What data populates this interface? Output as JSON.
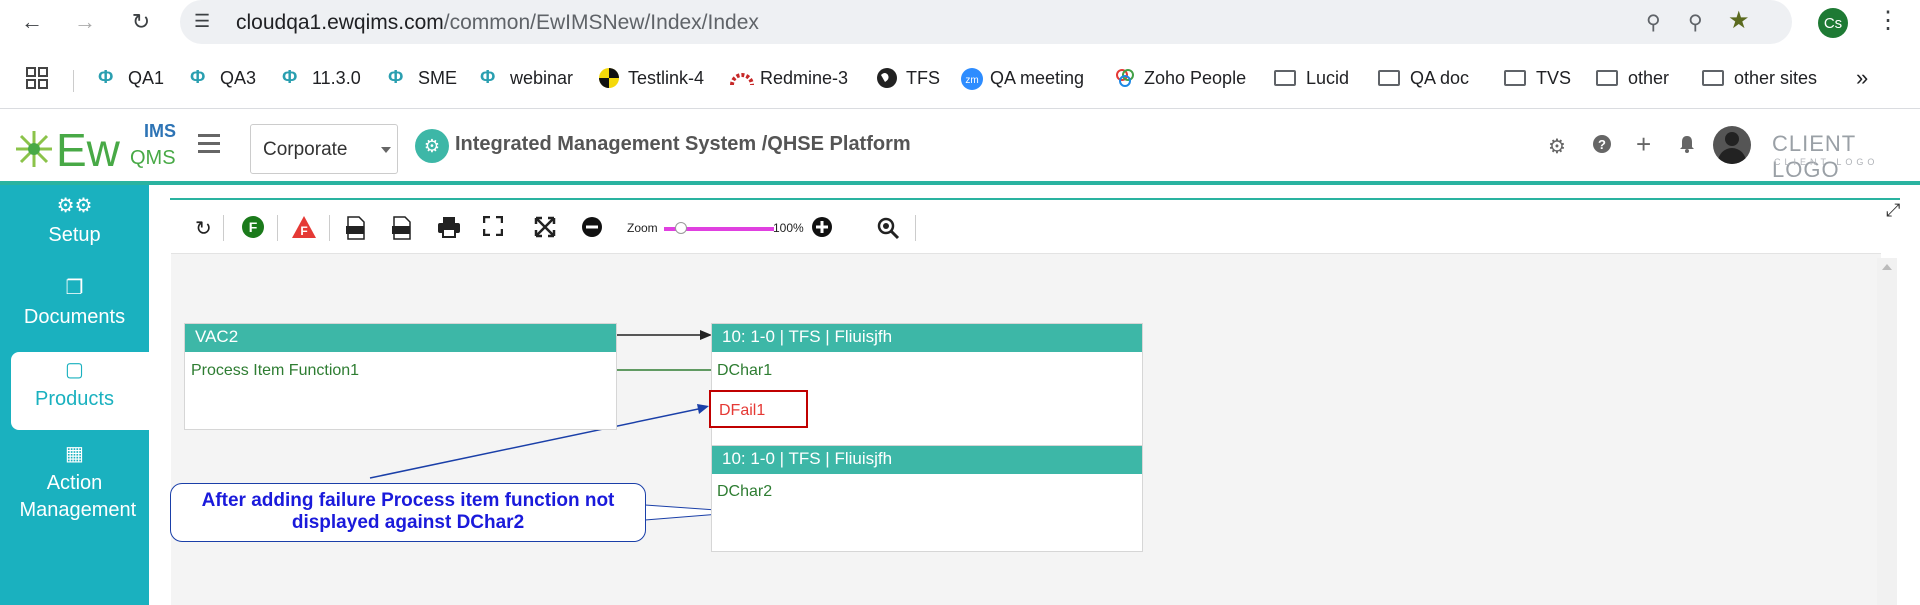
{
  "browser": {
    "url_host": "cloudqa1.ewqims.com",
    "url_path": "/common/EwIMSNew/Index/Index",
    "profile_initials": "Cs",
    "bookmarks": [
      {
        "label": "QA1",
        "icon": "ew-icon"
      },
      {
        "label": "QA3",
        "icon": "ew-icon"
      },
      {
        "label": "11.3.0",
        "icon": "ew-icon"
      },
      {
        "label": "SME",
        "icon": "ew-icon"
      },
      {
        "label": "webinar",
        "icon": "ew-icon"
      },
      {
        "label": "Testlink-4",
        "icon": "testlink-icon"
      },
      {
        "label": "Redmine-3",
        "icon": "redmine-icon"
      },
      {
        "label": "TFS",
        "icon": "globe-icon"
      },
      {
        "label": "QA meeting",
        "icon": "zoom-icon"
      },
      {
        "label": "Zoho People",
        "icon": "zoho-icon"
      },
      {
        "label": "Lucid",
        "icon": "folder-icon"
      },
      {
        "label": "QA doc",
        "icon": "folder-icon"
      },
      {
        "label": "TVS",
        "icon": "folder-icon"
      },
      {
        "label": "other",
        "icon": "folder-icon"
      },
      {
        "label": "other sites",
        "icon": "folder-icon"
      }
    ]
  },
  "header": {
    "logo_ew": "Ew",
    "logo_ims": "IMS",
    "logo_qms": "QMS",
    "org_select": "Corporate",
    "title": "Integrated Management System /QHSE Platform",
    "client_logo": "CLIENT LOGO",
    "client_logo_sub": "CLIENT LOGO"
  },
  "sidebar": {
    "items": [
      {
        "label": "Setup",
        "icon": "gears-icon"
      },
      {
        "label": "Documents",
        "icon": "documents-icon"
      },
      {
        "label": "Products",
        "icon": "products-icon",
        "active": true
      },
      {
        "label": "Action Management",
        "icon": "building-icon"
      }
    ]
  },
  "toolbar": {
    "zoom_label": "Zoom",
    "zoom_value": "100%",
    "zoom_level": 0.15,
    "f_green": "F",
    "f_red": "F"
  },
  "diagram": {
    "node_vac2": {
      "title": "VAC2",
      "item": "Process Item Function1"
    },
    "node_tfs1": {
      "title": "10: 1-0 | TFS | Fliuisjfh",
      "item": "DChar1"
    },
    "failure_box": "DFail1",
    "node_tfs2": {
      "title": "10: 1-0 | TFS | Fliuisjfh",
      "item": "DChar2"
    },
    "callout": "After adding failure Process item function not displayed against DChar2"
  },
  "colors": {
    "teal_header": "#3db7a7",
    "sidebar": "#1ab1bf",
    "failure": "#c00000",
    "callout_text": "#1a1adb"
  }
}
